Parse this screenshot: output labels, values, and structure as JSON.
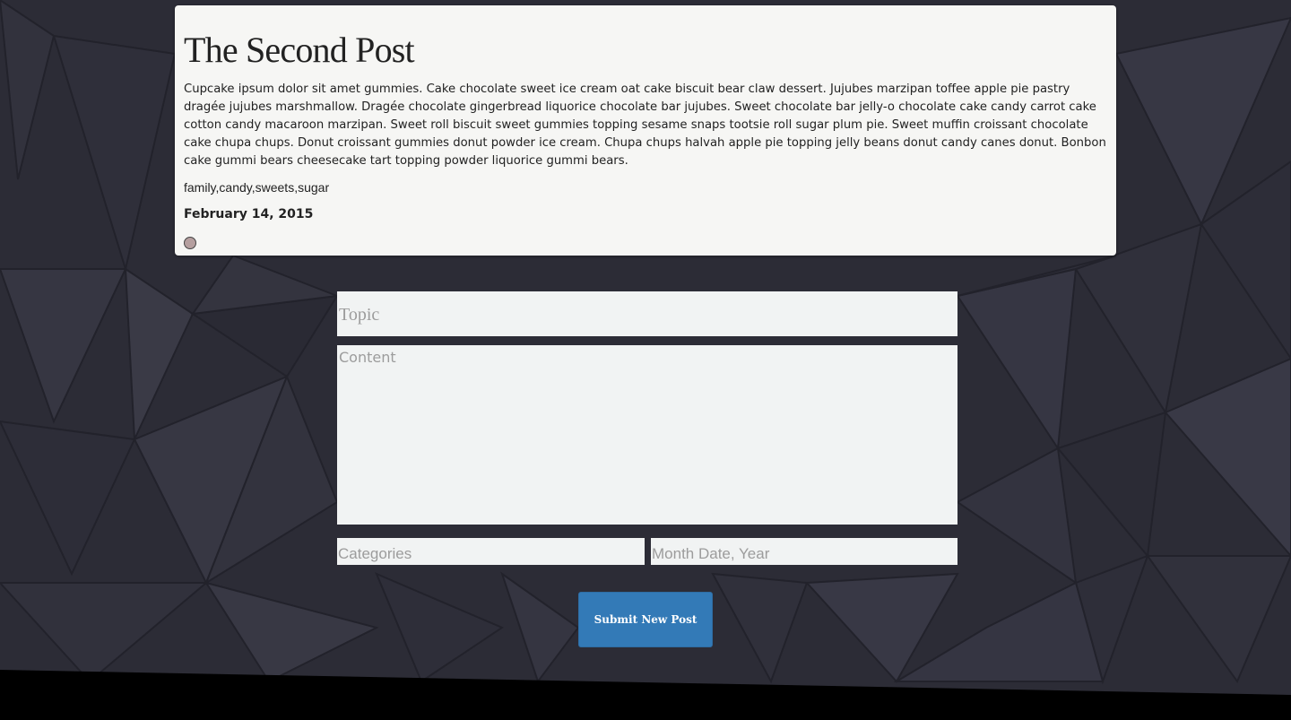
{
  "post": {
    "title": "The Second Post",
    "body": "Cupcake ipsum dolor sit amet gummies. Cake chocolate sweet ice cream oat cake biscuit bear claw dessert. Jujubes marzipan toffee apple pie pastry dragée jujubes marshmallow. Dragée chocolate gingerbread liquorice chocolate bar jujubes. Sweet chocolate bar jelly-o chocolate cake candy carrot cake cotton candy macaroon marzipan. Sweet roll biscuit sweet gummies topping sesame snaps tootsie roll sugar plum pie. Sweet muffin croissant chocolate cake chupa chups. Donut croissant gummies donut powder ice cream. Chupa chups halvah apple pie topping jelly beans donut candy canes donut. Bonbon cake gummi bears cheesecake tart topping powder liquorice gummi bears.",
    "tags": "family,candy,sweets,sugar",
    "date": "February 14, 2015",
    "dot_icon": "circle-dot-icon",
    "dot_color": "#b59f9f"
  },
  "form": {
    "topic_placeholder": "Topic",
    "content_placeholder": "Content",
    "categories_placeholder": "Categories",
    "date_placeholder": "Month Date, Year",
    "submit_label": "Submit New Post"
  },
  "colors": {
    "background": "#2c2c36",
    "card": "#f6f6f4",
    "field": "#f1f3f3",
    "button": "#337ab7",
    "footer": "#000000"
  }
}
